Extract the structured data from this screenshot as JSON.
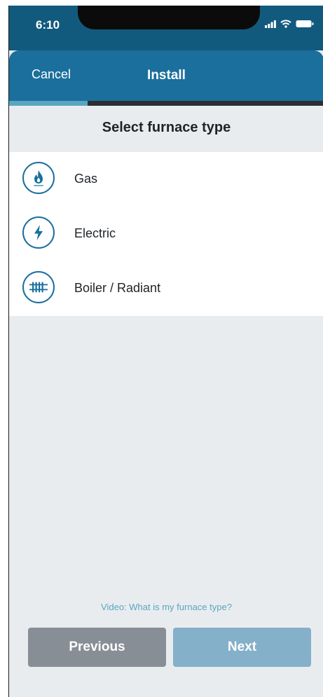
{
  "status_bar": {
    "time": "6:10"
  },
  "nav": {
    "cancel_label": "Cancel",
    "title": "Install"
  },
  "progress": {
    "fraction": 0.25
  },
  "page": {
    "title": "Select furnace type"
  },
  "options": [
    {
      "label": "Gas",
      "icon": "flame-icon"
    },
    {
      "label": "Electric",
      "icon": "lightning-icon"
    },
    {
      "label": "Boiler / Radiant",
      "icon": "radiator-icon"
    }
  ],
  "help": {
    "video_link": "Video: What is my furnace type?"
  },
  "buttons": {
    "previous_label": "Previous",
    "next_label": "Next"
  },
  "colors": {
    "header": "#1a6f9d",
    "accent": "#5aa6c0",
    "background": "#e9ecef",
    "previous_button": "#878e96",
    "next_button": "#84b0c9"
  }
}
